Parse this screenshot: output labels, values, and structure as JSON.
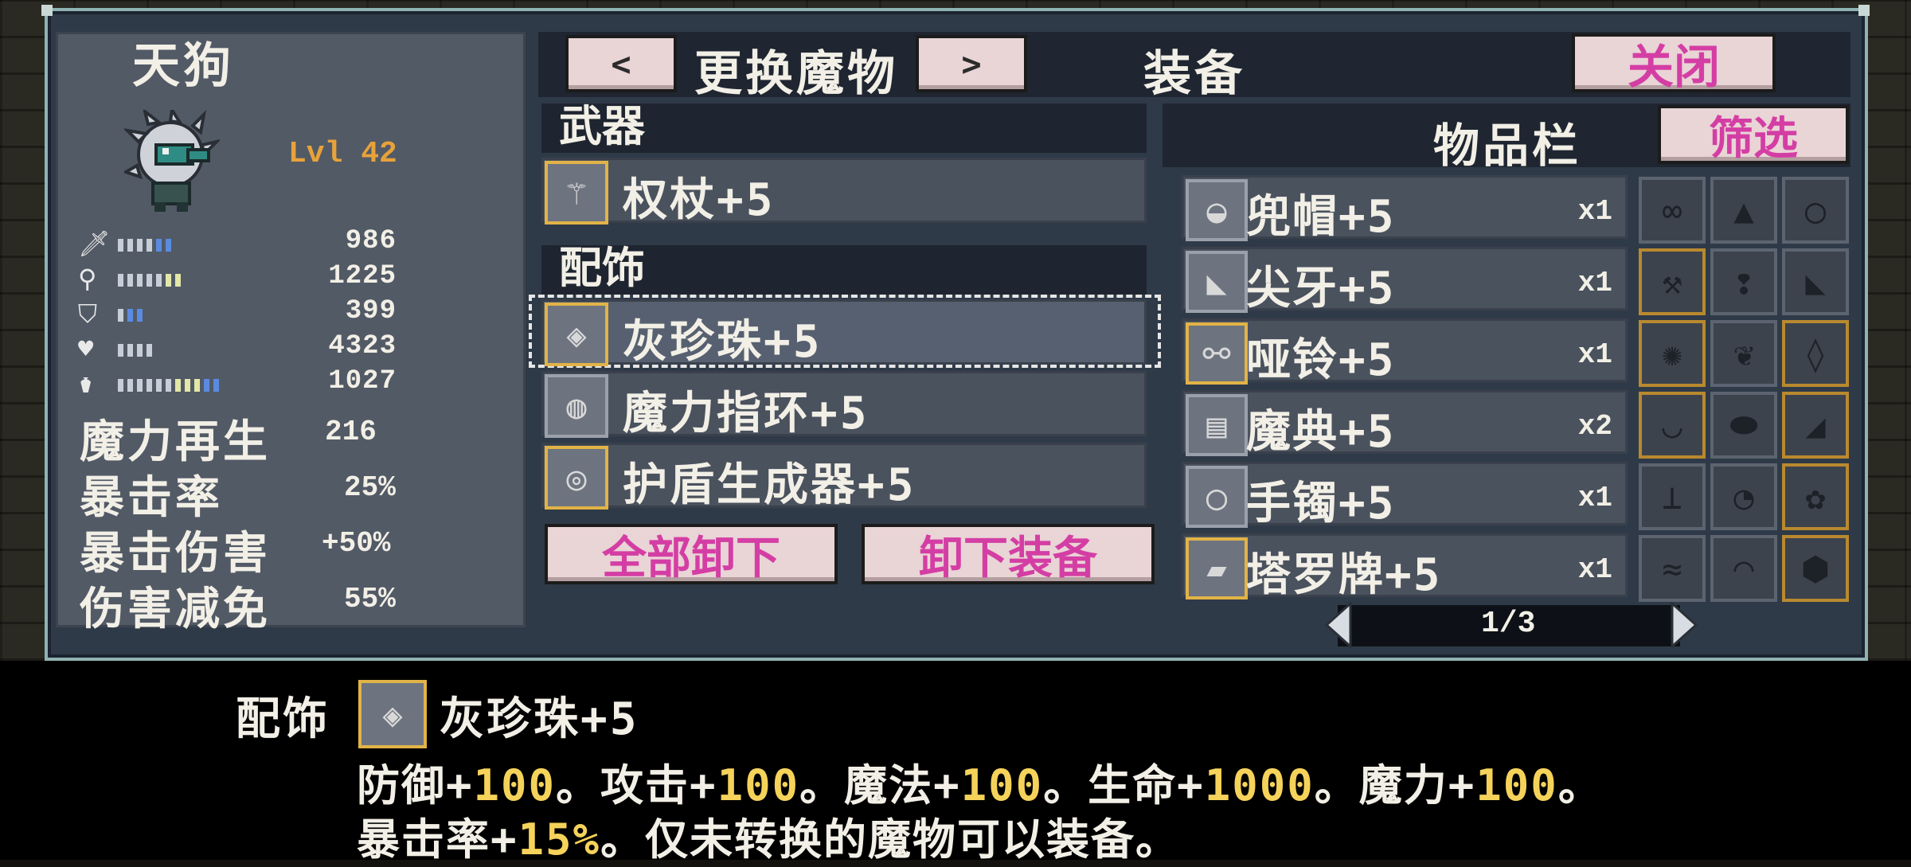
{
  "monster": {
    "name": "天狗",
    "level": "Lvl 42",
    "stats": [
      {
        "icon": "sword-icon",
        "value": "986"
      },
      {
        "icon": "wand-icon",
        "value": "1225"
      },
      {
        "icon": "shield-icon",
        "value": "399"
      },
      {
        "icon": "heart-icon",
        "value": "4323"
      },
      {
        "icon": "potion-icon",
        "value": "1027"
      }
    ],
    "secondary": [
      {
        "label": "魔力再生",
        "value": "216"
      },
      {
        "label": "暴击率",
        "value": "25%"
      },
      {
        "label": "暴击伤害",
        "value": "+50%"
      },
      {
        "label": "伤害减免",
        "value": "55%"
      }
    ]
  },
  "header": {
    "prev_label": "<",
    "switch_label": "更换魔物",
    "next_label": ">",
    "equip_title": "装备",
    "close_label": "关闭"
  },
  "equipment": {
    "weapon_title": "武器",
    "weapon": "权杖+5",
    "accessory_title": "配饰",
    "accessories": [
      "灰珍珠+5",
      "魔力指环+5",
      "护盾生成器+5"
    ],
    "unequip_all": "全部卸下",
    "unequip": "卸下装备"
  },
  "inventory": {
    "title": "物品栏",
    "filter_label": "筛选",
    "items": [
      {
        "name": "兜帽+5",
        "qty": "x1",
        "icon": "hood-icon"
      },
      {
        "name": "尖牙+5",
        "qty": "x1",
        "icon": "fang-icon"
      },
      {
        "name": "哑铃+5",
        "qty": "x1",
        "icon": "dumbbell-icon"
      },
      {
        "name": "魔典+5",
        "qty": "x2",
        "icon": "tome-icon"
      },
      {
        "name": "手镯+5",
        "qty": "x1",
        "icon": "bracelet-icon"
      },
      {
        "name": "塔罗牌+5",
        "qty": "x1",
        "icon": "tarot-icon"
      }
    ],
    "page": "1/3"
  },
  "description": {
    "category": "配饰",
    "item": "灰珍珠+5",
    "line1": [
      {
        "t": "防御+",
        "g": false
      },
      {
        "t": "100",
        "g": true
      },
      {
        "t": "。攻击+",
        "g": false
      },
      {
        "t": "100",
        "g": true
      },
      {
        "t": "。魔法+",
        "g": false
      },
      {
        "t": "100",
        "g": true
      },
      {
        "t": "。生命+",
        "g": false
      },
      {
        "t": "1000",
        "g": true
      },
      {
        "t": "。魔力+",
        "g": false
      },
      {
        "t": "100",
        "g": true
      },
      {
        "t": "。",
        "g": false
      }
    ],
    "line2": [
      {
        "t": "暴击率+",
        "g": false
      },
      {
        "t": "15%",
        "g": true
      },
      {
        "t": "。仅未转换的魔物可以装备。",
        "g": false
      }
    ]
  },
  "colors": {
    "gold": "#f5d25a",
    "pink": "#d43ea4",
    "level": "#e8a23a"
  }
}
